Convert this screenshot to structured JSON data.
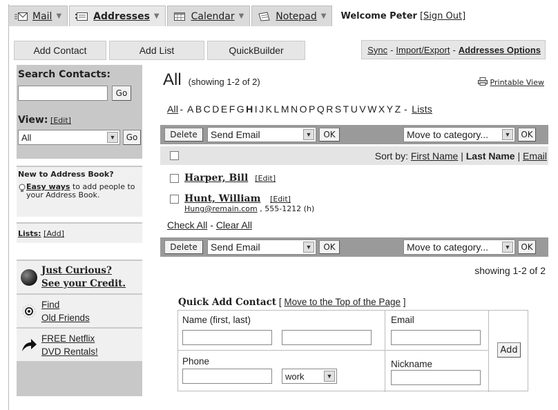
{
  "tabs": [
    {
      "label": "Mail",
      "icon": "mail-icon",
      "active": false
    },
    {
      "label": "Addresses",
      "icon": "address-book-icon",
      "active": true
    },
    {
      "label": "Calendar",
      "icon": "calendar-icon",
      "active": false
    },
    {
      "label": "Notepad",
      "icon": "notepad-icon",
      "active": false
    }
  ],
  "welcome": {
    "text": "Welcome Peter",
    "sign_out": "[Sign Out]"
  },
  "toolbar": {
    "add_contact": "Add Contact",
    "add_list": "Add List",
    "quickbuilder": "QuickBuilder",
    "sync": "Sync",
    "sep1": "-",
    "import_export": "Import/Export",
    "sep2": "-",
    "addresses_options": "Addresses Options"
  },
  "sidebar": {
    "search_label": "Search Contacts:",
    "search_value": "",
    "go": "Go",
    "view_label": "View:",
    "view_edit": "[Edit]",
    "view_value": "All",
    "view_go": "Go",
    "new_heading": "New to Address Book?",
    "easy_ways": "Easy ways",
    "easy_rest": " to add people to your Address Book.",
    "lists_label": "Lists:",
    "lists_add": "[Add]",
    "promos": [
      {
        "line1": "Just Curious?",
        "line2": "See your Credit.",
        "icon": "globe-icon"
      },
      {
        "line1": "Find",
        "line2": "Old Friends",
        "icon": "target-icon"
      },
      {
        "line1": "FREE Netflix",
        "line2": "DVD Rentals!",
        "icon": "arrow-icon"
      }
    ]
  },
  "main": {
    "title": "All",
    "showing": "(showing 1-2 of 2)",
    "printable": "Printable View",
    "alpha_all": "All",
    "alpha_sep": "-",
    "letters": [
      "A",
      "B",
      "C",
      "D",
      "E",
      "F",
      "G",
      "H",
      "I",
      "J",
      "K",
      "L",
      "M",
      "N",
      "O",
      "P",
      "Q",
      "R",
      "S",
      "T",
      "U",
      "V",
      "W",
      "X",
      "Y",
      "Z"
    ],
    "bold_letters": [
      "H"
    ],
    "alpha_sep2": "-",
    "lists_link": "Lists",
    "delete": "Delete",
    "send_email": "Send Email",
    "ok": "OK",
    "move_to": "Move to category...",
    "sort_by": "Sort by:",
    "sort_first": "First Name",
    "sort_pipe1": "|",
    "sort_last": "Last Name",
    "sort_pipe2": "|",
    "sort_email": "Email",
    "contacts": [
      {
        "name": "Harper, Bill",
        "edit": "[Edit]",
        "email": "",
        "phone": ""
      },
      {
        "name": "Hunt, William",
        "edit": "[Edit]",
        "email": "Hung@remain.com",
        "phone": " , 555-1212 (h)"
      }
    ],
    "check_all": "Check All",
    "check_sep": "-",
    "clear_all": "Clear All",
    "showing_bottom": "showing 1-2 of 2"
  },
  "quick_add": {
    "title": "Quick Add Contact",
    "bracket_open": "[",
    "move_top": "Move to the Top of the Page",
    "bracket_close": "]",
    "name_label": "Name (first, last)",
    "email_label": "Email",
    "phone_label": "Phone",
    "phone_type": "work",
    "nickname_label": "Nickname",
    "add": "Add"
  }
}
